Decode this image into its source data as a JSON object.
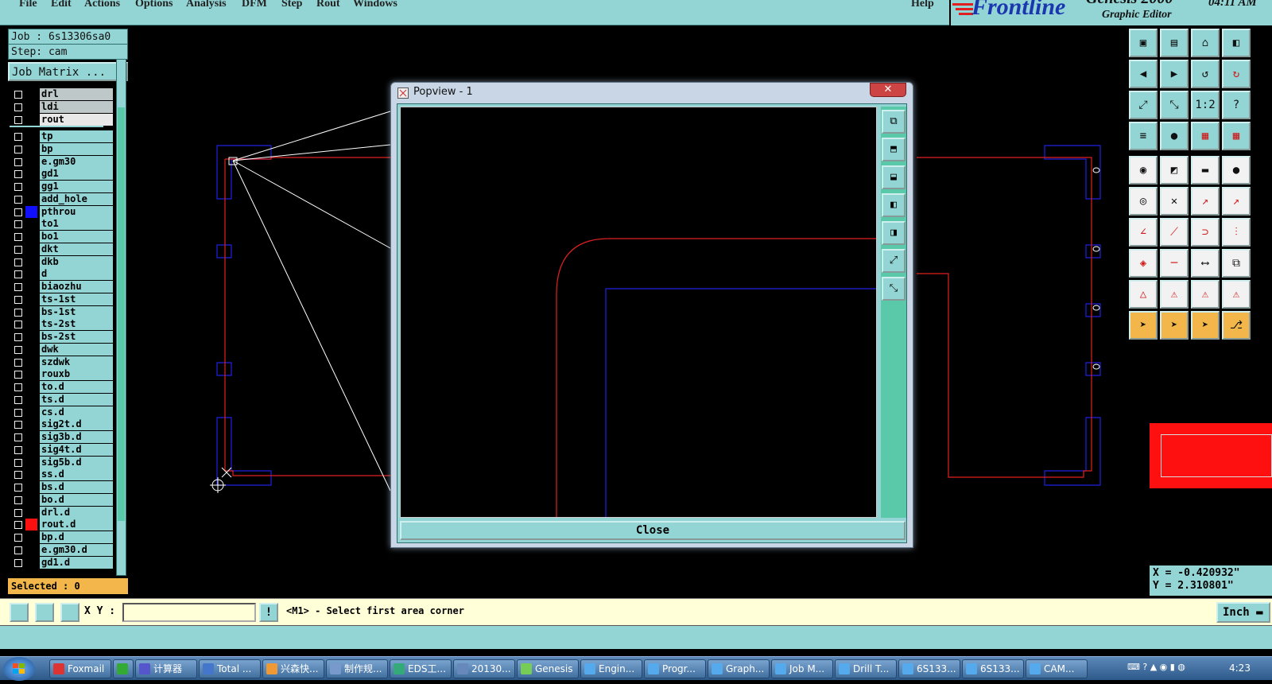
{
  "menubar": {
    "items": [
      "File",
      "Edit",
      "Actions",
      "Options",
      "Analysis",
      "DFM",
      "Step",
      "Rout",
      "Windows"
    ],
    "help": "Help"
  },
  "logo": {
    "brand": "Frontline",
    "product": "Genesis 2000",
    "subtitle": "Graphic Editor",
    "clock": "04:11 AM"
  },
  "job": {
    "job_label": "Job : 6s13306sa0",
    "step_label": "Step: cam",
    "matrix_button": "Job Matrix ..."
  },
  "layers": [
    {
      "name": "drl",
      "bg": "gray"
    },
    {
      "name": "ldi",
      "bg": "gray"
    },
    {
      "name": "rout",
      "bg": "white"
    },
    {
      "name": "tp"
    },
    {
      "name": "bp"
    },
    {
      "name": "e.gm30"
    },
    {
      "name": "gd1",
      "mark": "⬋"
    },
    {
      "name": "gg1"
    },
    {
      "name": "add_hole"
    },
    {
      "name": "pthrou",
      "color": "#1010ff",
      "mark": "▦"
    },
    {
      "name": "to1",
      "mark": "⬋"
    },
    {
      "name": "bo1",
      "mark": "⬋"
    },
    {
      "name": "dkt"
    },
    {
      "name": "dkb"
    },
    {
      "name": "d"
    },
    {
      "name": "biaozhu"
    },
    {
      "name": "ts-1st"
    },
    {
      "name": "bs-1st"
    },
    {
      "name": "ts-2st"
    },
    {
      "name": "bs-2st"
    },
    {
      "name": "dwk"
    },
    {
      "name": "szdwk"
    },
    {
      "name": "rouxb"
    },
    {
      "name": "to.d",
      "mark": "⬋"
    },
    {
      "name": "ts.d"
    },
    {
      "name": "cs.d"
    },
    {
      "name": "sig2t.d",
      "mark": "⬋"
    },
    {
      "name": "sig3b.d"
    },
    {
      "name": "sig4t.d",
      "mark": "⬋"
    },
    {
      "name": "sig5b.d"
    },
    {
      "name": "ss.d",
      "mark": "⬋"
    },
    {
      "name": "bs.d"
    },
    {
      "name": "bo.d",
      "mark": "⬋"
    },
    {
      "name": "drl.d"
    },
    {
      "name": "rout.d",
      "color": "#ff1010"
    },
    {
      "name": "bp.d"
    },
    {
      "name": "e.gm30.d"
    },
    {
      "name": "gd1.d",
      "mark": "⬋"
    }
  ],
  "selected": "Selected : 0",
  "coords": {
    "x": "X = -0.420932\"",
    "y": "Y = 2.310801\""
  },
  "cmd": {
    "xy_label": "X Y :",
    "xy_value": "",
    "prompt": "<M1> - Select first area corner",
    "units": "Inch"
  },
  "popview": {
    "title": "Popview - 1",
    "close_label": "Close"
  },
  "taskbar": {
    "tasks": [
      "Foxmail",
      "",
      "计算器",
      "Total ...",
      "兴森快...",
      "制作规...",
      "EDS工...",
      "20130...",
      "Genesis",
      "Engin...",
      "Progr...",
      "Graph...",
      "Job M...",
      "Drill T...",
      "6S133...",
      "6S133...",
      "CAM..."
    ],
    "clock": "4:23"
  },
  "colors": {
    "panel": "#93d4d4",
    "accent": "#f2b64a",
    "outline_red": "#e02020",
    "outline_blue": "#2020e0",
    "selection": "#ff1010"
  }
}
